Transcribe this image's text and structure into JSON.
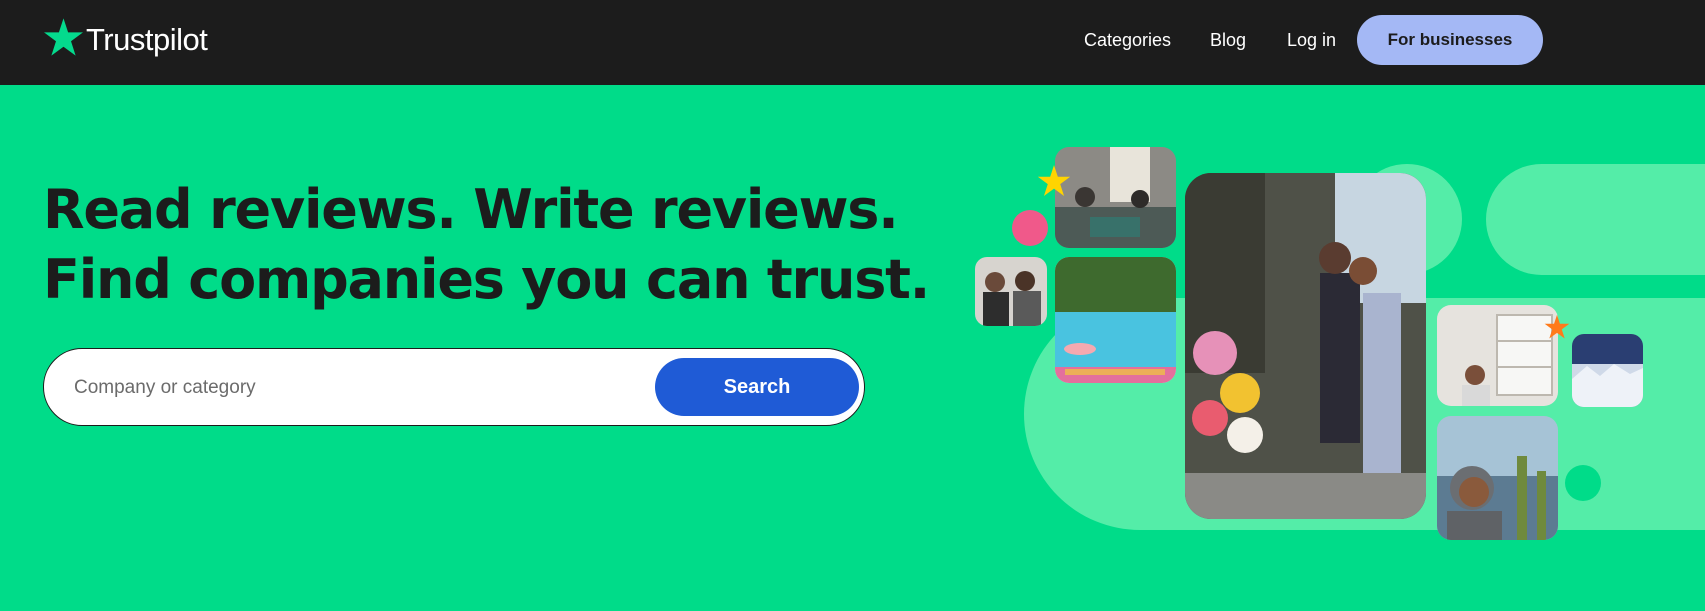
{
  "header": {
    "logo_text": "Trustpilot",
    "nav": {
      "categories": "Categories",
      "blog": "Blog",
      "login": "Log in",
      "for_businesses": "For businesses"
    }
  },
  "hero": {
    "headline_line1": "Read reviews. Write reviews.",
    "headline_line2": "Find companies you can trust."
  },
  "search": {
    "placeholder": "Company or category",
    "value": "",
    "button_label": "Search"
  },
  "colors": {
    "header_bg": "#1c1c1c",
    "hero_bg": "#00dc89",
    "brand_star": "#04da8d",
    "search_button": "#1f5bd6",
    "business_button": "#a4b8f5",
    "accent_pink": "#f0598a",
    "accent_yellow": "#ffd400",
    "accent_orange": "#ff7a1a"
  },
  "icons": {
    "logo_star": "trustpilot-star-icon",
    "decor_star_yellow": "star-icon",
    "decor_star_orange": "star-icon"
  }
}
